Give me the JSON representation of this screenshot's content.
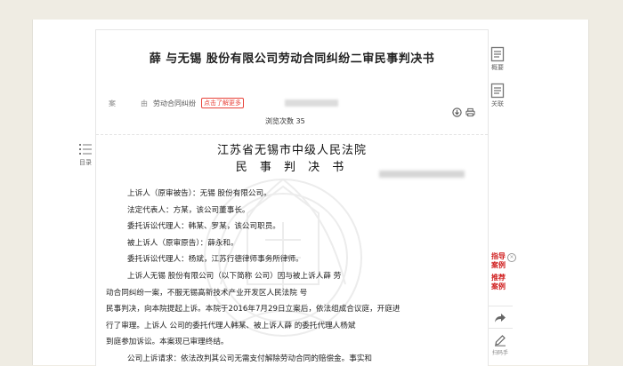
{
  "document": {
    "title": "薛 与无锡 股份有限公司劳动合同纠纷二审民事判决书",
    "meta_label": "案",
    "cause_label": "由",
    "cause_value": "劳动合同纠纷",
    "tip": "点击了解更多",
    "views_label": "浏览次数",
    "views_count": "35",
    "court_name": "江苏省无锡市中级人民法院",
    "doc_type": "民 事 判 决 书",
    "lines": [
      "上诉人（原审被告）：无锡 股份有限公司。",
      "法定代表人：方某，该公司董事长。",
      "委托诉讼代理人：韩某、罗某，该公司职员。",
      "被上诉人（原审原告）：薛永和。",
      "委托诉讼代理人：杨斌，江苏行德律师事务所律师。",
      "上诉人无锡 股份有限公司（以下简称 公司）因与被上诉人薛 劳",
      "动合同纠纷一案，不服无锡高新技术产业开发区人民法院 号",
      "民事判决，向本院提起上诉。本院于2016年7月29日立案后，依法组成合议庭，开庭进",
      "行了审理。上诉人 公司的委托代理人韩某、被上诉人薛 的委托代理人杨斌",
      "到庭参加诉讼。本案现已审理终结。",
      "公司上诉请求：依法改判其公司无需支付解除劳动合同的赔偿金。事实和"
    ]
  },
  "left_nav": {
    "label": "目录",
    "icon": "menu-list-icon"
  },
  "right_nav": [
    {
      "label": "概要",
      "icon": "summary-doc-icon"
    },
    {
      "label": "关联",
      "icon": "related-doc-icon"
    }
  ],
  "case_links": [
    {
      "label": "指导\n案例"
    },
    {
      "label": "推荐\n案例"
    }
  ],
  "side_actions": [
    {
      "label": "",
      "icon": "share-icon"
    },
    {
      "label": "扫码手",
      "icon": "edit-icon"
    }
  ],
  "colors": {
    "background": "#efece3",
    "accent_red": "#d02020"
  }
}
